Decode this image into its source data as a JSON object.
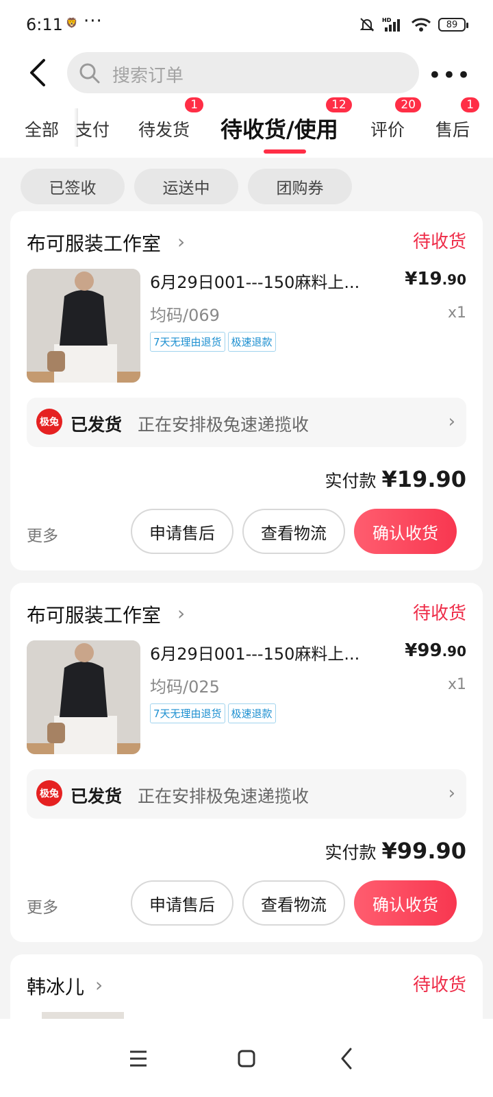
{
  "status_bar": {
    "time": "6:11",
    "battery": "89"
  },
  "search": {
    "placeholder": "搜索订单"
  },
  "tabs": [
    {
      "label": "全部",
      "badge": ""
    },
    {
      "label": "支付",
      "badge": ""
    },
    {
      "label": "待发货",
      "badge": "1"
    },
    {
      "label": "待收货/使用",
      "badge": "12"
    },
    {
      "label": "评价",
      "badge": "20"
    },
    {
      "label": "售后",
      "badge": "1"
    }
  ],
  "sub_filters": [
    "已签收",
    "运送中",
    "团购券"
  ],
  "orders": [
    {
      "shop": "布可服装工作室",
      "status": "待收货",
      "title": "6月29日001---150麻料上...",
      "price_main": "¥19",
      "price_dec": ".90",
      "spec": "均码/069",
      "qty": "x1",
      "tags": [
        "7天无理由退货",
        "极速退款"
      ],
      "logistics_logo": "极兔",
      "logistics_status": "已发货",
      "logistics_detail": "正在安排极兔速递揽收",
      "paid_label": "实付款",
      "paid_amount": "¥19.90",
      "more": "更多",
      "btn_aftersale": "申请售后",
      "btn_logistics": "查看物流",
      "btn_confirm": "确认收货"
    },
    {
      "shop": "布可服装工作室",
      "status": "待收货",
      "title": "6月29日001---150麻料上...",
      "price_main": "¥99",
      "price_dec": ".90",
      "spec": "均码/025",
      "qty": "x1",
      "tags": [
        "7天无理由退货",
        "极速退款"
      ],
      "logistics_logo": "极兔",
      "logistics_status": "已发货",
      "logistics_detail": "正在安排极兔速递揽收",
      "paid_label": "实付款",
      "paid_amount": "¥99.90",
      "more": "更多",
      "btn_aftersale": "申请售后",
      "btn_logistics": "查看物流",
      "btn_confirm": "确认收货"
    },
    {
      "shop": "韩冰儿",
      "status": "待收货"
    }
  ],
  "colors": {
    "accent": "#ee2c48",
    "badge": "#ff2e46",
    "tag_blue": "#1c8fd0"
  }
}
